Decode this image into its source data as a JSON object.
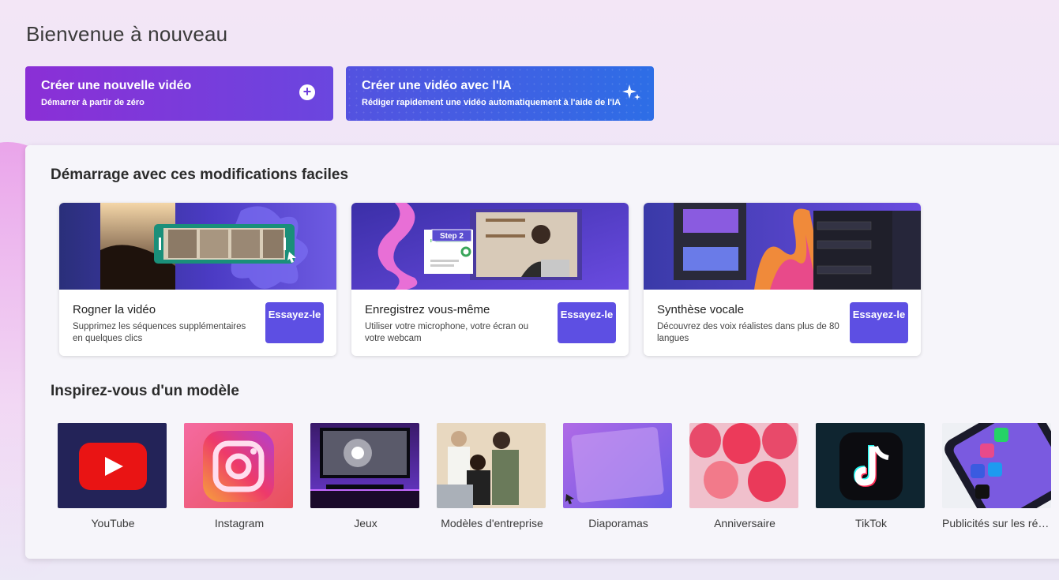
{
  "header": {
    "title": "Bienvenue à nouveau"
  },
  "cta": {
    "new": {
      "title": "Créer une nouvelle vidéo",
      "subtitle": "Démarrer à partir de zéro",
      "icon": "plus-circle-icon"
    },
    "ai": {
      "title": "Créer une vidéo avec l'IA",
      "subtitle": "Rédiger rapidement une vidéo automatiquement à l'aide de l'IA",
      "icon": "sparkle-icon"
    }
  },
  "easy_edits": {
    "title": "Démarrage avec ces modifications faciles",
    "cards": [
      {
        "title": "Rogner la vidéo",
        "description": "Supprimez les séquences supplémentaires en quelques clics",
        "button": "Essayez-le"
      },
      {
        "title": "Enregistrez vous-même",
        "description": "Utiliser votre microphone, votre écran ou votre webcam",
        "button": "Essayez-le",
        "badge": "Step 2"
      },
      {
        "title": "Synthèse vocale",
        "description": "Découvrez des voix réalistes dans plus de 80 langues",
        "button": "Essayez-le"
      }
    ]
  },
  "templates": {
    "title": "Inspirez-vous d'un modèle",
    "items": [
      {
        "label": "YouTube"
      },
      {
        "label": "Instagram"
      },
      {
        "label": "Jeux"
      },
      {
        "label": "Modèles d'entreprise"
      },
      {
        "label": "Diaporamas"
      },
      {
        "label": "Anniversaire"
      },
      {
        "label": "TikTok"
      },
      {
        "label": "Publicités sur les réseaux sociaux"
      }
    ]
  },
  "colors": {
    "primary_button": "#5d4fe3",
    "cta_new": "#8b2fd6",
    "cta_ai": "#2d6ee6"
  }
}
